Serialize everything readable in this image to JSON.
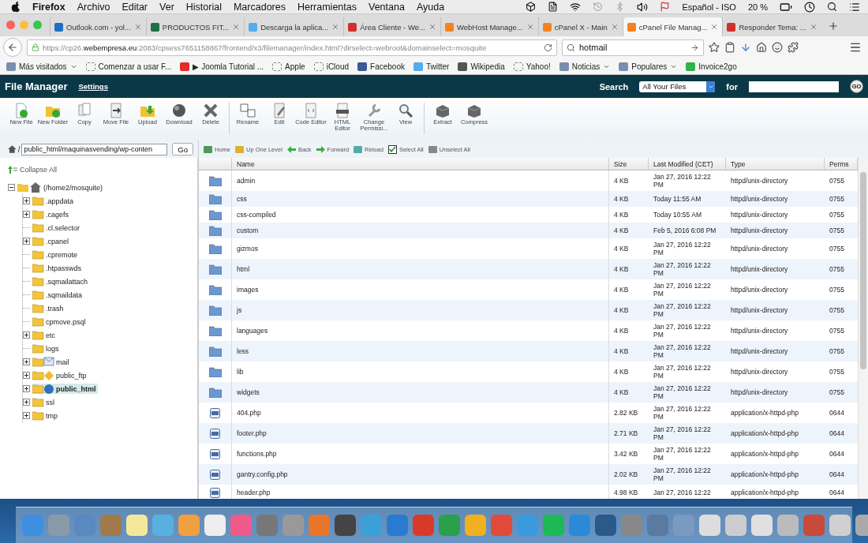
{
  "menu_bar": {
    "app": "Firefox",
    "menus": [
      "Archivo",
      "Editar",
      "Ver",
      "Historial",
      "Marcadores",
      "Herramientas",
      "Ventana",
      "Ayuda"
    ],
    "input_source": "Español - ISO",
    "battery": "20 %"
  },
  "browser_tabs": [
    {
      "title": "Outlook.com - yol...",
      "selected": false,
      "color": "#1e6fc3"
    },
    {
      "title": "PRODUCTOS FIT...",
      "selected": false,
      "color": "#1d7145"
    },
    {
      "title": "Descarga la aplica...",
      "selected": false,
      "color": "#55acee"
    },
    {
      "title": "Área Cliente - We...",
      "selected": false,
      "color": "#d0312d"
    },
    {
      "title": "WebHost Manage...",
      "selected": false,
      "color": "#f58220"
    },
    {
      "title": "cPanel X - Main",
      "selected": false,
      "color": "#f58220"
    },
    {
      "title": "cPanel File Manag...",
      "selected": true,
      "color": "#f58220"
    },
    {
      "title": "Responder Tema: ...",
      "selected": false,
      "color": "#d0312d"
    }
  ],
  "address_bar": {
    "url": "https://cp26.**webempresa.eu**:2083/cpsess7651158867/frontend/x3/filemanager/index.html?dirselect=webroot&domainselect=mosquite",
    "search": "hotmail"
  },
  "bookmarks": [
    {
      "label": "Más visitados",
      "kind": "menu",
      "color": "#7a8fb0"
    },
    {
      "label": "Comenzar a usar F...",
      "kind": "page"
    },
    {
      "label": "▶ Joomla Tutorial ...",
      "kind": "site",
      "color": "#e52d27"
    },
    {
      "label": "Apple",
      "kind": "page"
    },
    {
      "label": "iCloud",
      "kind": "page"
    },
    {
      "label": "Facebook",
      "kind": "site",
      "color": "#3b5998"
    },
    {
      "label": "Twitter",
      "kind": "site",
      "color": "#55acee"
    },
    {
      "label": "Wikipedia",
      "kind": "site",
      "color": "#555555"
    },
    {
      "label": "Yahoo!",
      "kind": "page"
    },
    {
      "label": "Noticias",
      "kind": "menu",
      "color": "#7a8fb0"
    },
    {
      "label": "Populares",
      "kind": "menu",
      "color": "#7a8fb0"
    },
    {
      "label": "Invoice2go",
      "kind": "site",
      "color": "#2fb34a"
    }
  ],
  "file_manager": {
    "title": "File Manager",
    "settings": "Settings",
    "search_label": "Search",
    "search_scope": "All Your Files",
    "for_label": "for",
    "go": "GO"
  },
  "toolbar": {
    "groups": [
      [
        "New File",
        "New Folder",
        "Copy",
        "Move File",
        "Upload",
        "Download",
        "Delete"
      ],
      [
        "Rename",
        "Edit",
        "Code Editor",
        "HTML Editor",
        "Change Permissi...",
        "View"
      ],
      [
        "Extract",
        "Compress"
      ]
    ]
  },
  "path_bar": {
    "separator": "/",
    "path": "public_html/maquinasvending/wp-conten",
    "go": "Go"
  },
  "nav_actions": [
    "Home",
    "Up One Level",
    "Back",
    "Forward",
    "Reload",
    "Select All",
    "Unselect All"
  ],
  "tree": {
    "collapse_all": "Collapse All",
    "root": {
      "label": "(/home2/mosquite)",
      "expanded": true,
      "children": [
        {
          "label": ".appdata",
          "kind": "folder",
          "expandable": true,
          "selected": false
        },
        {
          "label": ".cagefs",
          "kind": "folder",
          "expandable": true,
          "selected": false
        },
        {
          "label": ".cl.selector",
          "kind": "folder",
          "expandable": false,
          "selected": false
        },
        {
          "label": ".cpanel",
          "kind": "folder",
          "expandable": true,
          "selected": false
        },
        {
          "label": ".cpremote",
          "kind": "folder",
          "expandable": false,
          "selected": false
        },
        {
          "label": ".htpasswds",
          "kind": "folder",
          "expandable": false,
          "selected": false
        },
        {
          "label": ".sqmailattach",
          "kind": "folder",
          "expandable": false,
          "selected": false
        },
        {
          "label": ".sqmaildata",
          "kind": "folder",
          "expandable": false,
          "selected": false
        },
        {
          "label": ".trash",
          "kind": "folder",
          "expandable": false,
          "selected": false
        },
        {
          "label": "cpmove.psql",
          "kind": "folder",
          "expandable": false,
          "selected": false
        },
        {
          "label": "etc",
          "kind": "folder",
          "expandable": true,
          "selected": false
        },
        {
          "label": "logs",
          "kind": "folder",
          "expandable": false,
          "selected": false
        },
        {
          "label": "mail",
          "kind": "mail",
          "expandable": true,
          "selected": false
        },
        {
          "label": "public_ftp",
          "kind": "ftp",
          "expandable": true,
          "selected": false
        },
        {
          "label": "public_html",
          "kind": "web",
          "expandable": true,
          "selected": true
        },
        {
          "label": "ssl",
          "kind": "folder",
          "expandable": true,
          "selected": false
        },
        {
          "label": "tmp",
          "kind": "folder",
          "expandable": true,
          "selected": false
        }
      ]
    }
  },
  "table": {
    "columns": [
      "Name",
      "Size",
      "Last Modified (CET)",
      "Type",
      "Perms"
    ],
    "rows": [
      {
        "kind": "folder",
        "name": "admin",
        "size": "4 KB",
        "modified": "Jan 27, 2016 12:22 PM",
        "type": "httpd/unix-directory",
        "perms": "0755"
      },
      {
        "kind": "folder",
        "name": "css",
        "size": "4 KB",
        "modified": "Today 11:55 AM",
        "type": "httpd/unix-directory",
        "perms": "0755"
      },
      {
        "kind": "folder",
        "name": "css-compiled",
        "size": "4 KB",
        "modified": "Today 10:55 AM",
        "type": "httpd/unix-directory",
        "perms": "0755"
      },
      {
        "kind": "folder",
        "name": "custom",
        "size": "4 KB",
        "modified": "Feb 5, 2016 6:08 PM",
        "type": "httpd/unix-directory",
        "perms": "0755"
      },
      {
        "kind": "folder",
        "name": "gizmos",
        "size": "4 KB",
        "modified": "Jan 27, 2016 12:22 PM",
        "type": "httpd/unix-directory",
        "perms": "0755"
      },
      {
        "kind": "folder",
        "name": "html",
        "size": "4 KB",
        "modified": "Jan 27, 2016 12:22 PM",
        "type": "httpd/unix-directory",
        "perms": "0755"
      },
      {
        "kind": "folder",
        "name": "images",
        "size": "4 KB",
        "modified": "Jan 27, 2016 12:22 PM",
        "type": "httpd/unix-directory",
        "perms": "0755"
      },
      {
        "kind": "folder",
        "name": "js",
        "size": "4 KB",
        "modified": "Jan 27, 2016 12:22 PM",
        "type": "httpd/unix-directory",
        "perms": "0755"
      },
      {
        "kind": "folder",
        "name": "languages",
        "size": "4 KB",
        "modified": "Jan 27, 2016 12:22 PM",
        "type": "httpd/unix-directory",
        "perms": "0755"
      },
      {
        "kind": "folder",
        "name": "less",
        "size": "4 KB",
        "modified": "Jan 27, 2016 12:22 PM",
        "type": "httpd/unix-directory",
        "perms": "0755"
      },
      {
        "kind": "folder",
        "name": "lib",
        "size": "4 KB",
        "modified": "Jan 27, 2016 12:22 PM",
        "type": "httpd/unix-directory",
        "perms": "0755"
      },
      {
        "kind": "folder",
        "name": "widgets",
        "size": "4 KB",
        "modified": "Jan 27, 2016 12:22 PM",
        "type": "httpd/unix-directory",
        "perms": "0755"
      },
      {
        "kind": "php",
        "name": "404.php",
        "size": "2.82 KB",
        "modified": "Jan 27, 2016 12:22 PM",
        "type": "application/x-httpd-php",
        "perms": "0644"
      },
      {
        "kind": "php",
        "name": "footer.php",
        "size": "2.71 KB",
        "modified": "Jan 27, 2016 12:22 PM",
        "type": "application/x-httpd-php",
        "perms": "0644"
      },
      {
        "kind": "php",
        "name": "functions.php",
        "size": "3.42 KB",
        "modified": "Jan 27, 2016 12:22 PM",
        "type": "application/x-httpd-php",
        "perms": "0644"
      },
      {
        "kind": "php",
        "name": "gantry.config.php",
        "size": "2.02 KB",
        "modified": "Jan 27, 2016 12:22 PM",
        "type": "application/x-httpd-php",
        "perms": "0644"
      },
      {
        "kind": "php",
        "name": "header.php",
        "size": "4.98 KB",
        "modified": "Jan 27, 2016 12:22",
        "type": "application/x-httpd-php",
        "perms": "0644"
      }
    ]
  }
}
